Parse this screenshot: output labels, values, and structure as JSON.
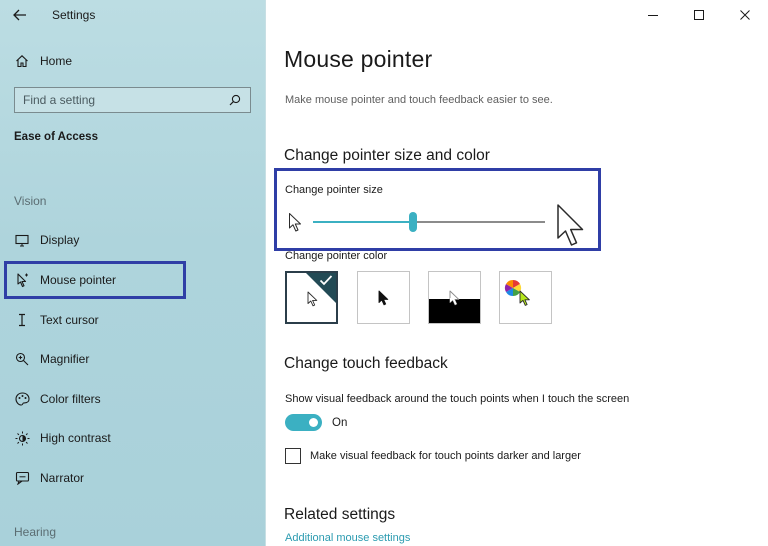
{
  "window": {
    "title": "Settings",
    "controls": [
      "minimize",
      "maximize",
      "close"
    ]
  },
  "sidebar": {
    "home_label": "Home",
    "search_placeholder": "Find a setting",
    "section_header": "Ease of Access",
    "groups": [
      {
        "label": "Vision"
      },
      {
        "label": "Hearing"
      }
    ],
    "items": [
      {
        "label": "Display",
        "icon": "monitor-icon"
      },
      {
        "label": "Mouse pointer",
        "icon": "mouse-pointer-icon",
        "selected": true
      },
      {
        "label": "Text cursor",
        "icon": "text-cursor-icon"
      },
      {
        "label": "Magnifier",
        "icon": "magnifier-icon"
      },
      {
        "label": "Color filters",
        "icon": "color-filters-icon"
      },
      {
        "label": "High contrast",
        "icon": "high-contrast-icon"
      },
      {
        "label": "Narrator",
        "icon": "narrator-icon"
      }
    ]
  },
  "main": {
    "title": "Mouse pointer",
    "description": "Make mouse pointer and touch feedback easier to see.",
    "pointer_section": {
      "heading": "Change pointer size and color",
      "size_label": "Change pointer size",
      "size_value": 0.43,
      "color_label": "Change pointer color",
      "color_options": [
        {
          "name": "white",
          "selected": true
        },
        {
          "name": "black",
          "selected": false
        },
        {
          "name": "inverted",
          "selected": false
        },
        {
          "name": "custom",
          "selected": false
        }
      ]
    },
    "touch_section": {
      "heading": "Change touch feedback",
      "show_feedback_label": "Show visual feedback around the touch points when I touch the screen",
      "toggle_state": "On",
      "toggle_on": true,
      "darker_label": "Make visual feedback for touch points darker and larger",
      "darker_checked": false
    },
    "related": {
      "heading": "Related settings",
      "link": "Additional mouse settings"
    }
  },
  "colors": {
    "accent": "#3bb0c2",
    "highlight_box": "#2f3ea6",
    "sidebar_bg": "#aed4dc",
    "swatch_selected_corner": "#224a55"
  }
}
